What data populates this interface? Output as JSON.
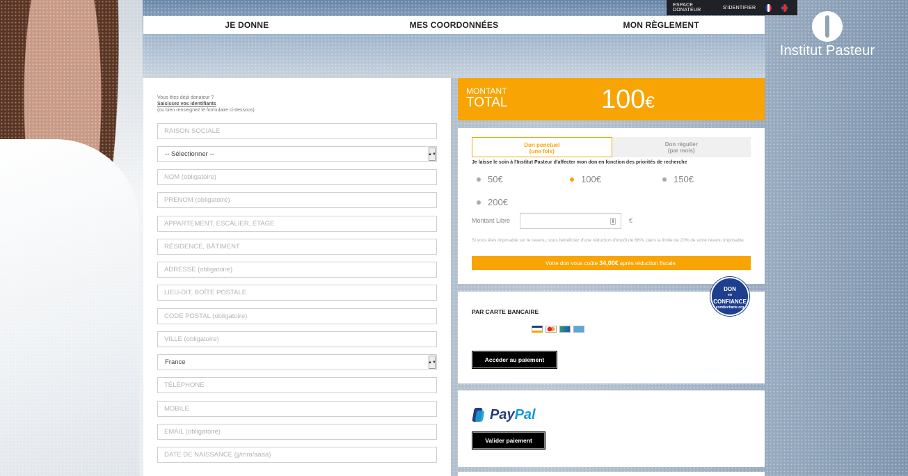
{
  "topbar": {
    "espace": "ESPACE DONATEUR",
    "login": "S'IDENTIFIER"
  },
  "logo": {
    "text": "Institut Pasteur"
  },
  "tabs": [
    "JE DONNE",
    "MES COORDONNÉES",
    "MON RÈGLEMENT"
  ],
  "form": {
    "intro_q": "Vous êtes déjà donateur ?",
    "intro_link": "Saisissez vos identifiants",
    "intro_alt": "(ou bien renseignez le formulaire ci-dessous)",
    "fields": [
      "RAISON SOCIALE",
      "-- Sélectionner --",
      "NOM (obligatoire)",
      "PRENOM (obligatoire)",
      "APPARTEMENT, ESCALIER, ÉTAGE",
      "RÉSIDENCE, BÂTIMENT",
      "ADRESSE (obligatoire)",
      "LIEU-DIT, BOÎTE POSTALE",
      "CODE POSTAL (obligatoire)",
      "VILLE (obligatoire)",
      "France",
      "TÉLÉPHONE",
      "MOBILE",
      "EMAIL (obligatoire)",
      "DATE DE NAISSANCE (jj/mm/aaaa)"
    ]
  },
  "total": {
    "label1": "MONTANT",
    "label2": "TOTAL",
    "amount": "100",
    "currency": "€",
    "accent": "#f7a404"
  },
  "don": {
    "tab_ponctuel": "Don ponctuel",
    "tab_ponctuel_sub": "(une fois)",
    "tab_regulier": "Don régulier",
    "tab_regulier_sub": "(par mois)",
    "note": "Je laisse le soin à l'Institut Pasteur d'affecter mon don en fonction des priorités de recherche",
    "amounts": [
      "50€",
      "100€",
      "150€",
      "200€"
    ],
    "selected_amount": "100€",
    "libre_label": "Montant Libre",
    "libre_currency": "€",
    "tax_info": "Si vous êtes imposable sur le revenu, vous bénéficiez d'une réduction d'impôt de 66%, dans la limite de 20% de votre revenu imposable.",
    "tax_pre": "Votre don vous coûte",
    "tax_amount": "34,00€",
    "tax_post": "après réduction fiscale."
  },
  "card": {
    "title": "PAR CARTE BANCAIRE",
    "button": "Accéder au paiement"
  },
  "badge": {
    "line1": "DON",
    "line2": "en",
    "line3": "CONFIANCE",
    "line4": "comitecharte.org"
  },
  "paypal": {
    "pay": "Pay",
    "pal": "Pal",
    "button": "Valider paiement"
  }
}
